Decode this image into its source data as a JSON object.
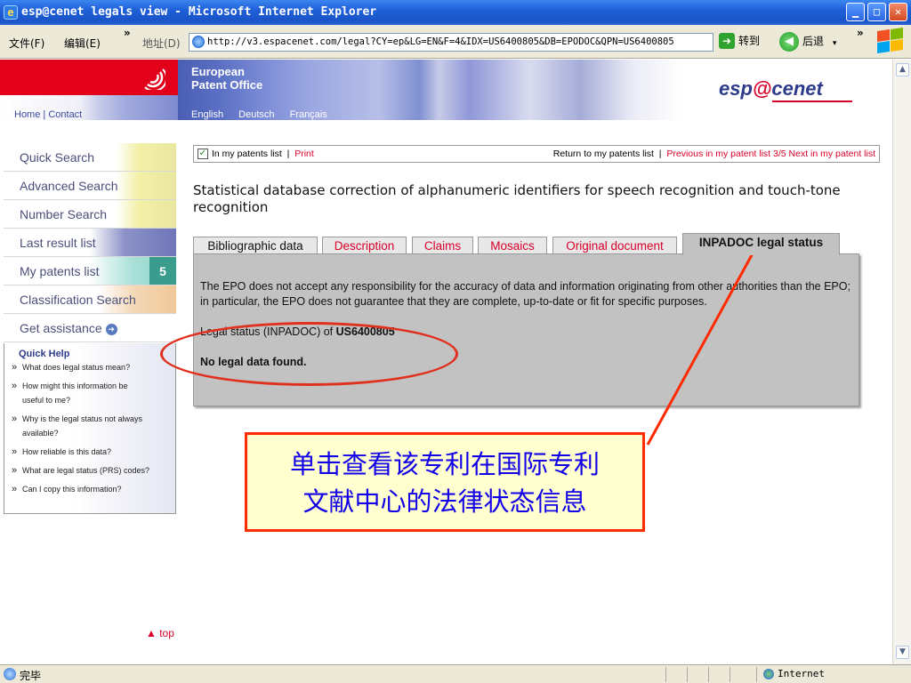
{
  "window": {
    "title": "esp@cenet legals view - Microsoft Internet Explorer",
    "minimize": "▁",
    "maximize": "□",
    "close": "✕"
  },
  "toolbar": {
    "menu_file": "文件(F)",
    "menu_edit": "编辑(E)",
    "chevron": "»",
    "address_label": "地址(D)",
    "url": "http://v3.espacenet.com/legal?CY=ep&LG=EN&F=4&IDX=US6400805&DB=EPODOC&QPN=US6400805",
    "go_label": "转到",
    "back_label": "后退",
    "dropdown": "▾"
  },
  "header": {
    "epo_name_line1": "European",
    "epo_name_line2": "Patent Office",
    "home": "Home",
    "contact": "Contact",
    "separator": "|",
    "languages": [
      "English",
      "Deutsch",
      "Français"
    ],
    "logo_pre": "esp",
    "logo_mid": "@",
    "logo_post": "cenet"
  },
  "nav": {
    "items": [
      {
        "label": "Quick Search"
      },
      {
        "label": "Advanced Search"
      },
      {
        "label": "Number Search"
      },
      {
        "label": "Last result list"
      },
      {
        "label": "My patents list",
        "badge": "5"
      },
      {
        "label": "Classification Search"
      },
      {
        "label": "Get assistance"
      }
    ],
    "quick_help_title": "Quick Help",
    "quick_help_items": [
      "What does legal status mean?",
      "How might this information be useful to me?",
      "Why is the legal status not always available?",
      "How reliable is this data?",
      "What are legal status (PRS) codes?",
      "Can I copy this information?"
    ],
    "top_link": "▲ top"
  },
  "content": {
    "in_my_patents": "In my patents list",
    "print": "Print",
    "return_link": "Return to my patents list",
    "previous": "Previous in my patent list",
    "position": "3/5",
    "next": "Next in my patent list",
    "patent_title": "Statistical database correction of alphanumeric identifiers for speech recognition and touch-tone recognition",
    "tabs": [
      {
        "label": "Bibliographic data"
      },
      {
        "label": "Description"
      },
      {
        "label": "Claims"
      },
      {
        "label": "Mosaics"
      },
      {
        "label": "Original document"
      },
      {
        "label": "INPADOC legal status"
      }
    ],
    "disclaimer": "The EPO does not accept any responsibility for the accuracy of data and information originating from other authorities than the EPO; in particular, the EPO does not guarantee that they are complete, up-to-date or fit for specific purposes.",
    "legal_status_prefix": "Legal status (INPADOC) of",
    "patent_number": "US6400805",
    "no_data": "No legal data found."
  },
  "annotation": {
    "callout_line1": "单击查看该专利在国际专利",
    "callout_line2": "文献中心的法律状态信息",
    "color": "#ff2a00"
  },
  "statusbar": {
    "status": "完毕",
    "zone": "Internet"
  }
}
